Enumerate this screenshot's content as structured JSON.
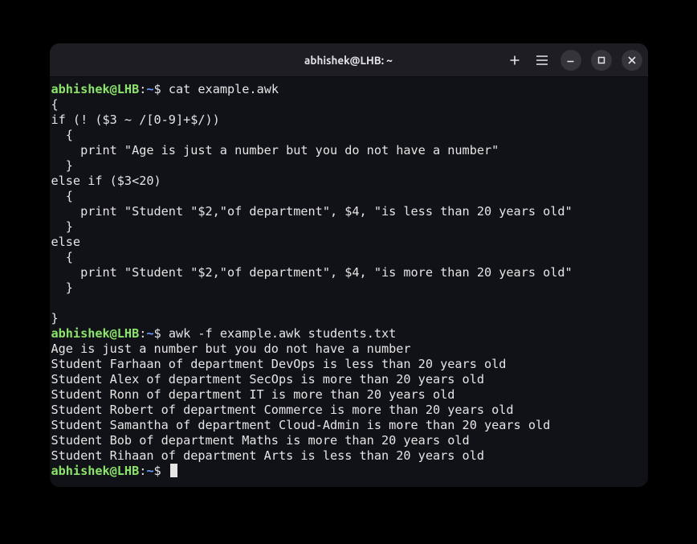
{
  "titlebar": {
    "title": "abhishek@LHB: ~"
  },
  "prompt": {
    "user": "abhishek@LHB",
    "sep1": ":",
    "path": "~",
    "dollar": "$ "
  },
  "cmd1": "cat example.awk",
  "script": [
    "{",
    "if (! ($3 ~ /[0-9]+$/))",
    "  {",
    "    print \"Age is just a number but you do not have a number\"",
    "  }",
    "else if ($3<20)",
    "  {",
    "    print \"Student \"$2,\"of department\", $4, \"is less than 20 years old\"",
    "  }",
    "else",
    "  {",
    "    print \"Student \"$2,\"of department\", $4, \"is more than 20 years old\"",
    "  }",
    "",
    "}"
  ],
  "cmd2": "awk -f example.awk students.txt",
  "output": [
    "Age is just a number but you do not have a number",
    "Student Farhaan of department DevOps is less than 20 years old",
    "Student Alex of department SecOps is more than 20 years old",
    "Student Ronn of department IT is more than 20 years old",
    "Student Robert of department Commerce is more than 20 years old",
    "Student Samantha of department Cloud-Admin is more than 20 years old",
    "Student Bob of department Maths is more than 20 years old",
    "Student Rihaan of department Arts is less than 20 years old"
  ]
}
